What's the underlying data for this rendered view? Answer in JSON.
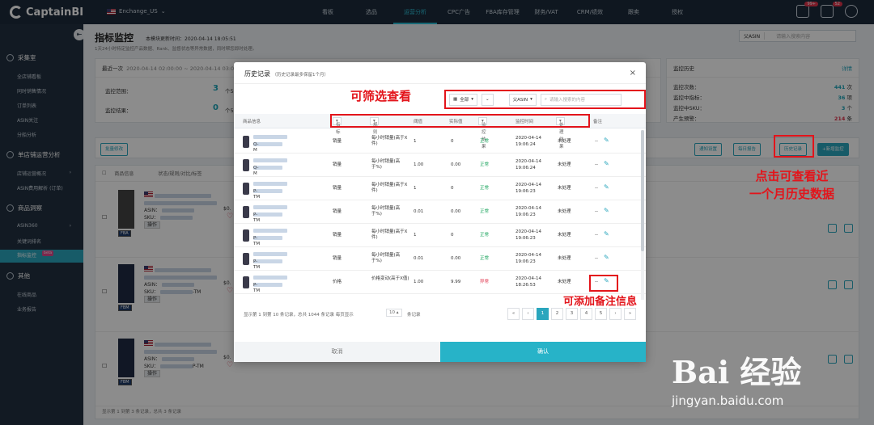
{
  "app": {
    "name": "CaptainBI",
    "store": "Enchange_US"
  },
  "nav": [
    "看板",
    "选品",
    "运营分析",
    "CPC广告",
    "FBA库存管理",
    "财务/VAT",
    "CRM/绩效",
    "跟卖",
    "授权"
  ],
  "nav_active": 2,
  "badges": {
    "msg": "99+",
    "notice": "52"
  },
  "sidebar": {
    "sections": [
      {
        "label": "采集室",
        "items": [
          "全店铺看板",
          "同时销售情况",
          "订单列表",
          "ASIN关注",
          "分船分析"
        ]
      },
      {
        "label": "单店铺运营分析",
        "items": [
          "店铺运营概况",
          "ASIN费用解析 (订单)"
        ]
      },
      {
        "label": "商品洞察",
        "items": [
          "ASIN360",
          "关键词排名",
          "指标监控"
        ]
      },
      {
        "label": "其他",
        "items": [
          "在线商品",
          "业务报告"
        ]
      }
    ],
    "active_item": "指标监控",
    "beta": "beta"
  },
  "page": {
    "title": "指标监控",
    "updated": "本模块更新时间：2020-04-14 18:05:51",
    "subtitle": "1天24小时特定监控产品数据、Rank、监督状态等异常数据，同时帮您即时处理。",
    "asin_select": "父ASIN",
    "search_placeholder": "请输入搜索内容"
  },
  "recent_card": {
    "title": "最近一次",
    "range": "2020-04-14 02:00:00 ~ 2020-04-14 03:00:00",
    "scope_label": "监控范围：",
    "scope_val": "3",
    "result_label": "监控结果：",
    "result_val": "0",
    "unit": "个5"
  },
  "history_card": {
    "title": "监控历史",
    "link": "详情",
    "rows": [
      {
        "label": "监控次数：",
        "val": "441",
        "unit": "次"
      },
      {
        "label": "监控中指标：",
        "val": "36",
        "unit": "项"
      },
      {
        "label": "监控中SKU：",
        "val": "3",
        "unit": "个"
      },
      {
        "label": "产生预警：",
        "val": "214",
        "unit": "条"
      }
    ]
  },
  "toolbar": {
    "batch": "批量修改",
    "notify": "通知设置",
    "daily": "每日报告",
    "history": "历史记录",
    "add": "+新增监控"
  },
  "list": {
    "headers": [
      "商品信息",
      "状态/规则/对比/标签",
      "操作"
    ],
    "price_prefix": "$0.",
    "fulfillment": [
      "FBA",
      "FBM",
      "FBM"
    ],
    "sku_suffix": [
      "",
      "-TM",
      "P-TM"
    ],
    "op": "操作",
    "footer": "显示第 1 到第 3 条记录，总共 3 条记录"
  },
  "modal": {
    "title": "历史记录",
    "note": "（历史记录最多保留1个月）",
    "filter_all": "全部",
    "asin_select": "父ASIN",
    "search_placeholder": "请输入搜索的内容",
    "headers": {
      "product": "商品信息",
      "metric": "指标",
      "rule": "规则",
      "threshold": "阈值",
      "actual": "实际值",
      "status": "监控结果",
      "time": "监控时间",
      "process": "处理结果",
      "note": "备注"
    },
    "rows": [
      {
        "sku": "Q-M",
        "metric": "销量",
        "rule": "每小时销量(高于X件)",
        "threshold": "1",
        "actual": "0",
        "status": "正常",
        "date": "2020-04-14",
        "time": "19:06:24",
        "process": "未处理",
        "note": "--"
      },
      {
        "sku": "Q-M",
        "metric": "销量",
        "rule": "每小时销量(高于%)",
        "threshold": "1.00",
        "actual": "0.00",
        "status": "正常",
        "date": "2020-04-14",
        "time": "19:06:24",
        "process": "未处理",
        "note": "--"
      },
      {
        "sku": "P-TM",
        "metric": "销量",
        "rule": "每小时销量(高于X件)",
        "threshold": "1",
        "actual": "0",
        "status": "正常",
        "date": "2020-04-14",
        "time": "19:06:23",
        "process": "未处理",
        "note": "--"
      },
      {
        "sku": "P-TM",
        "metric": "销量",
        "rule": "每小时销量(高于%)",
        "threshold": "0.01",
        "actual": "0.00",
        "status": "正常",
        "date": "2020-04-14",
        "time": "19:06:23",
        "process": "未处理",
        "note": "--"
      },
      {
        "sku": "P-TM",
        "metric": "销量",
        "rule": "每小时销量(高于X件)",
        "threshold": "1",
        "actual": "0",
        "status": "正常",
        "date": "2020-04-14",
        "time": "19:06:23",
        "process": "未处理",
        "note": "--"
      },
      {
        "sku": "P-TM",
        "metric": "销量",
        "rule": "每小时销量(高于%)",
        "threshold": "0.01",
        "actual": "0.00",
        "status": "正常",
        "date": "2020-04-14",
        "time": "19:06:23",
        "process": "未处理",
        "note": "--"
      },
      {
        "sku": "P-TM",
        "metric": "价格",
        "rule": "价格变动(高于X值)",
        "threshold": "1.00",
        "actual": "9.99",
        "status": "异常",
        "date": "2020-04-14",
        "time": "18:26:53",
        "process": "未处理",
        "note": "--"
      }
    ],
    "pager_text": "显示第 1 到第 10 条记录，总共 1044 条记录 每页显示",
    "page_size": "10",
    "page_size_suffix": "条记录",
    "pages": [
      "«",
      "‹",
      "1",
      "2",
      "3",
      "4",
      "5",
      "›",
      "»"
    ],
    "cancel": "取消",
    "confirm": "确认"
  },
  "annotations": {
    "filter": "可筛选查看",
    "history": "点击可查看近一个月历史数据",
    "history_line1": "点击可查看近",
    "history_line2": "一个月历史数据",
    "note": "可添加备注信息"
  },
  "watermark": {
    "brand": "Bai 经验",
    "url": "jingyan.baidu.com"
  }
}
